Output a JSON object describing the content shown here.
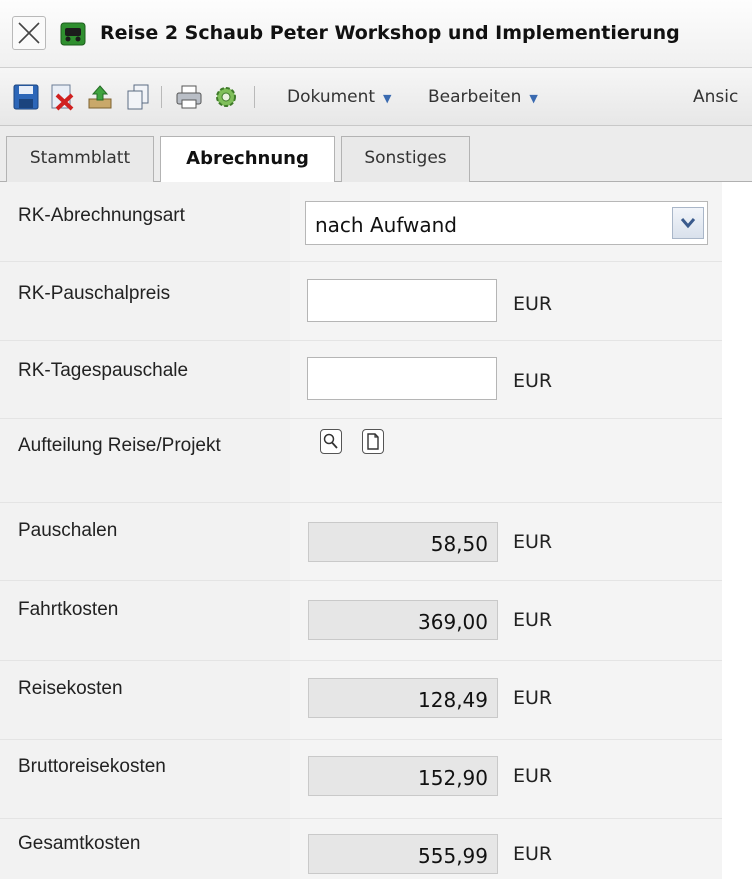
{
  "window": {
    "title": "Reise 2 Schaub Peter Workshop und Implementierung",
    "close_icon": "close-icon",
    "app_icon": "vehicle-icon"
  },
  "toolbar": {
    "buttons": [
      {
        "name": "save",
        "icon": "save-icon"
      },
      {
        "name": "delete",
        "icon": "delete-document-icon"
      },
      {
        "name": "export",
        "icon": "export-icon"
      },
      {
        "name": "copy",
        "icon": "copy-icon"
      },
      {
        "name": "print",
        "icon": "print-icon"
      },
      {
        "name": "settings",
        "icon": "gear-icon"
      }
    ],
    "menus": [
      "Dokument",
      "Bearbeiten",
      "Ansic"
    ]
  },
  "tabs": [
    {
      "label": "Stammblatt",
      "active": false
    },
    {
      "label": "Abrechnung",
      "active": true
    },
    {
      "label": "Sonstiges",
      "active": false
    }
  ],
  "form": {
    "abrechnungsart": {
      "label": "RK-Abrechnungsart",
      "value": "nach Aufwand"
    },
    "pauschalpreis": {
      "label": "RK-Pauschalpreis",
      "value": "",
      "unit": "EUR"
    },
    "tagespauschale": {
      "label": "RK-Tagespauschale",
      "value": "",
      "unit": "EUR"
    },
    "aufteilung": {
      "label": "Aufteilung Reise/Projekt"
    },
    "totals": [
      {
        "label": "Pauschalen",
        "value": "58,50",
        "unit": "EUR"
      },
      {
        "label": "Fahrtkosten",
        "value": "369,00",
        "unit": "EUR"
      },
      {
        "label": "Reisekosten",
        "value": "128,49",
        "unit": "EUR"
      },
      {
        "label": "Bruttoreisekosten",
        "value": "152,90",
        "unit": "EUR"
      },
      {
        "label": "Gesamtkosten",
        "value": "555,99",
        "unit": "EUR"
      }
    ]
  },
  "colors": {
    "select_arrow": "#3a5a8c",
    "menu_caret": "#3a6ab0"
  }
}
